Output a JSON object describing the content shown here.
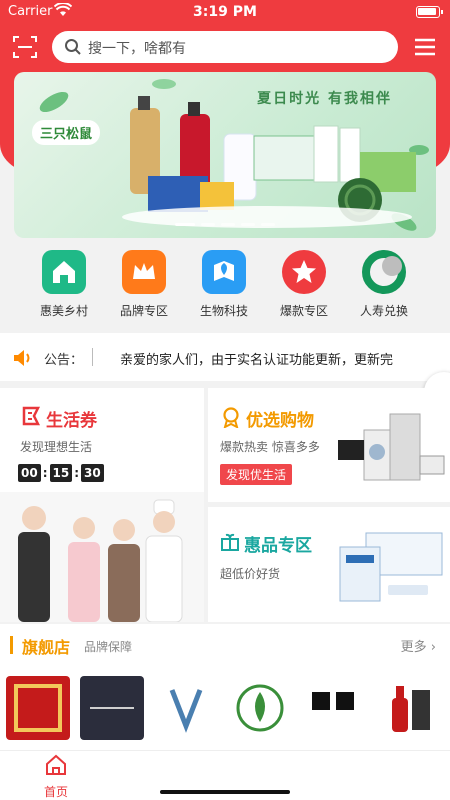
{
  "status": {
    "carrier": "Carrier",
    "time": "3:19 PM"
  },
  "search": {
    "placeholder": "搜一下，啥都有"
  },
  "banner": {
    "tagline": "夏日时光 有我相伴",
    "brand": "三只松鼠"
  },
  "categories": [
    {
      "label": "惠美乡村",
      "icon": "house-leaf-icon",
      "color": "#1fb987"
    },
    {
      "label": "品牌专区",
      "icon": "crown-icon",
      "color": "#ff7a1a"
    },
    {
      "label": "生物科技",
      "icon": "leaf-book-icon",
      "color": "#2a9df4"
    },
    {
      "label": "爆款专区",
      "icon": "star-icon",
      "color": "#ef3b3f"
    },
    {
      "label": "人寿兑换",
      "icon": "life-insurance-logo-icon",
      "color": "#14975a"
    }
  ],
  "notice": {
    "label": "公告：",
    "text": "亲爱的家人们，由于实名认证功能更新，更新完"
  },
  "life_card": {
    "title": "生活券",
    "subtitle": "发现理想生活",
    "timer": [
      "00",
      "15",
      "30"
    ]
  },
  "buy_card": {
    "title": "优选购物",
    "subtitle": "爆款热卖 惊喜多多",
    "button": "发现优生活"
  },
  "deal_card": {
    "title": "惠品专区",
    "subtitle": "超低价好货"
  },
  "flagship": {
    "title": "旗舰店",
    "subtitle": "品牌保障",
    "more": "更多"
  },
  "shops": [
    {
      "name": "金玺金店",
      "bg": "#c41b1b"
    },
    {
      "name": "ANNE",
      "bg": "#2b2d3c"
    },
    {
      "name": "V",
      "bg": "#ffffff"
    },
    {
      "name": "leaf-logo",
      "bg": "#ffffff"
    },
    {
      "name": "昂昂",
      "bg": "#ffffff"
    },
    {
      "name": "red-bottle",
      "bg": "#ffffff"
    }
  ],
  "tabbar": {
    "home": "首页"
  }
}
